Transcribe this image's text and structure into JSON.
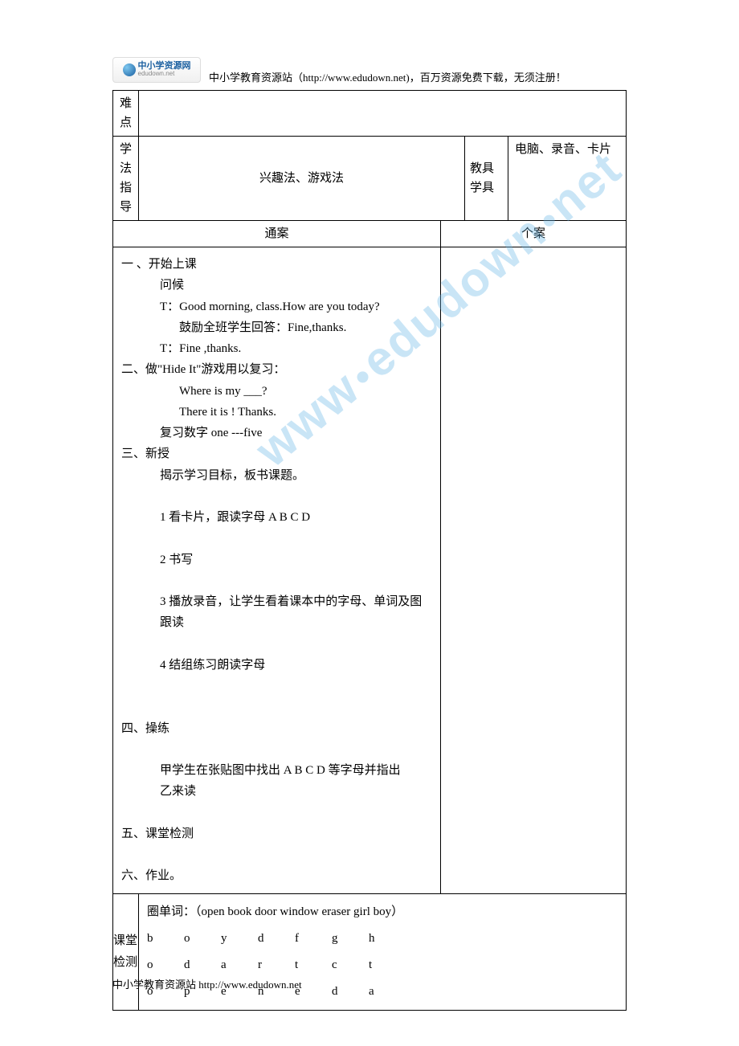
{
  "header": {
    "logo_title": "中小学资源网",
    "logo_sub": "edudown.net",
    "text": "中小学教育资源站（http://www.edudown.net)，百万资源免费下载，无须注册！"
  },
  "rows": {
    "difficulty_label": "难点",
    "difficulty_content": "",
    "method_label": "学法指导",
    "method_content": "兴趣法、游戏法",
    "tools_label": "教具学具",
    "tools_content": "电脑、录音、卡片",
    "plan_left_header": "通案",
    "plan_right_header": "个案"
  },
  "lesson": {
    "s1_title": "一 、开始上课",
    "s1_l1": "问候",
    "s1_l2": "T：Good morning, class.How are you today?",
    "s1_l3": "鼓励全班学生回答：Fine,thanks.",
    "s1_l4": "T：Fine ,thanks.",
    "s2_title": "二、做\"Hide It\"游戏用以复习：",
    "s2_l1": "Where is my ___?",
    "s2_l2": "There    it    is  !  Thanks.",
    "s2_l3": "复习数字 one ---five",
    "s3_title": "三、新授",
    "s3_l1": "揭示学习目标，板书课题。",
    "s3_l2": "1 看卡片，跟读字母  A    B    C    D",
    "s3_l3": "2  书写",
    "s3_l4": "3 播放录音，让学生看着课本中的字母、单词及图跟读",
    "s3_l5": "4  结组练习朗读字母",
    "s4_title": "四、操练",
    "s4_l1": "甲学生在张贴图中找出 A B C D 等字母并指出",
    "s4_l2": "乙来读",
    "s5_title": "五、课堂检测",
    "s6_title": "六、作业。"
  },
  "test": {
    "label": "课堂检测",
    "prompt": "圈单词：（open    book      door      window    eraser      girl     boy）",
    "grid": [
      [
        "b",
        "o",
        "y",
        "d",
        "f",
        "g",
        "h"
      ],
      [
        "o",
        "d",
        "a",
        "r",
        "t",
        "c",
        "t"
      ],
      [
        "o",
        "p",
        "e",
        "n",
        "e",
        "d",
        "a"
      ]
    ]
  },
  "footer": "中小学教育资源站  http://www.edudown.net",
  "watermark": {
    "p1": "www",
    "p2": "edudown",
    "p3": "net"
  }
}
